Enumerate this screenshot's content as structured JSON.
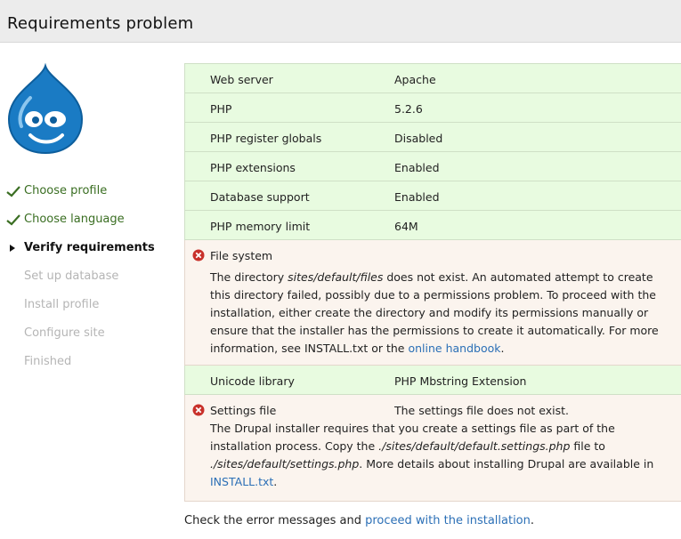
{
  "header": {
    "title": "Requirements problem"
  },
  "colors": {
    "success_row": "#e8fbe0",
    "error_row": "#fbf4ee",
    "link": "#2b6fb6",
    "check": "#3a6e22",
    "error": "#c8302a"
  },
  "steps": [
    {
      "label": "Choose profile",
      "state": "done",
      "icon": "check-icon"
    },
    {
      "label": "Choose language",
      "state": "done",
      "icon": "check-icon"
    },
    {
      "label": "Verify requirements",
      "state": "active",
      "icon": "triangle-right-icon"
    },
    {
      "label": "Set up database",
      "state": "todo"
    },
    {
      "label": "Install profile",
      "state": "todo"
    },
    {
      "label": "Configure site",
      "state": "todo"
    },
    {
      "label": "Finished",
      "state": "todo"
    }
  ],
  "requirements": [
    {
      "title": "Web server",
      "value": "Apache"
    },
    {
      "title": "PHP",
      "value": "5.2.6"
    },
    {
      "title": "PHP register globals",
      "value": "Disabled"
    },
    {
      "title": "PHP extensions",
      "value": "Enabled"
    },
    {
      "title": "Database support",
      "value": "Enabled"
    },
    {
      "title": "PHP memory limit",
      "value": "64M"
    },
    {
      "title": "File system",
      "value": "",
      "error": true,
      "desc": {
        "p1": "The directory ",
        "em1": "sites/default/files",
        "p2": " does not exist. An automated attempt to create this directory failed, possibly due to a permissions problem. To proceed with the installation, either create the directory and modify its permissions manually or ensure that the installer has the permissions to create it automatically. For more information, see INSTALL.txt or the ",
        "link": "online handbook",
        "p3": "."
      }
    },
    {
      "title": "Unicode library",
      "value": "PHP Mbstring Extension"
    },
    {
      "title": "Settings file",
      "value": "The settings file does not exist.",
      "error": true,
      "desc": {
        "p1": "The Drupal installer requires that you create a settings file as part of the installation process. Copy the ",
        "em1": "./sites/default/default.settings.php",
        "p2": " file to ",
        "em2": "./sites/default/settings.php",
        "p3": ". More details about installing Drupal are available in ",
        "link": "INSTALL.txt",
        "p4": "."
      }
    }
  ],
  "footer": {
    "text": "Check the error messages and ",
    "link": "proceed with the installation",
    "end": "."
  }
}
